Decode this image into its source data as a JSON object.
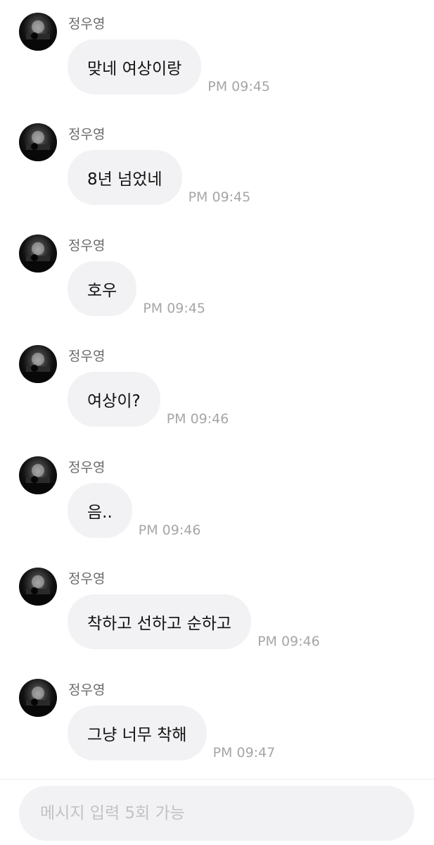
{
  "messages": [
    {
      "sender": "정우영",
      "text": "맞네 여상이랑",
      "time": "PM 09:45"
    },
    {
      "sender": "정우영",
      "text": "8년 넘었네",
      "time": "PM 09:45"
    },
    {
      "sender": "정우영",
      "text": "호우",
      "time": "PM 09:45"
    },
    {
      "sender": "정우영",
      "text": "여상이?",
      "time": "PM 09:46"
    },
    {
      "sender": "정우영",
      "text": "음..",
      "time": "PM 09:46"
    },
    {
      "sender": "정우영",
      "text": "착하고 선하고 순하고",
      "time": "PM 09:46"
    },
    {
      "sender": "정우영",
      "text": "그냥 너무 착해",
      "time": "PM 09:47"
    }
  ],
  "input": {
    "placeholder": "메시지 입력 5회 가능",
    "value": ""
  },
  "colors": {
    "bubble": "#f2f2f4",
    "sender": "#6b6b6b",
    "time": "#a6a6a6",
    "text": "#111111",
    "placeholder": "#c2c2c6"
  }
}
